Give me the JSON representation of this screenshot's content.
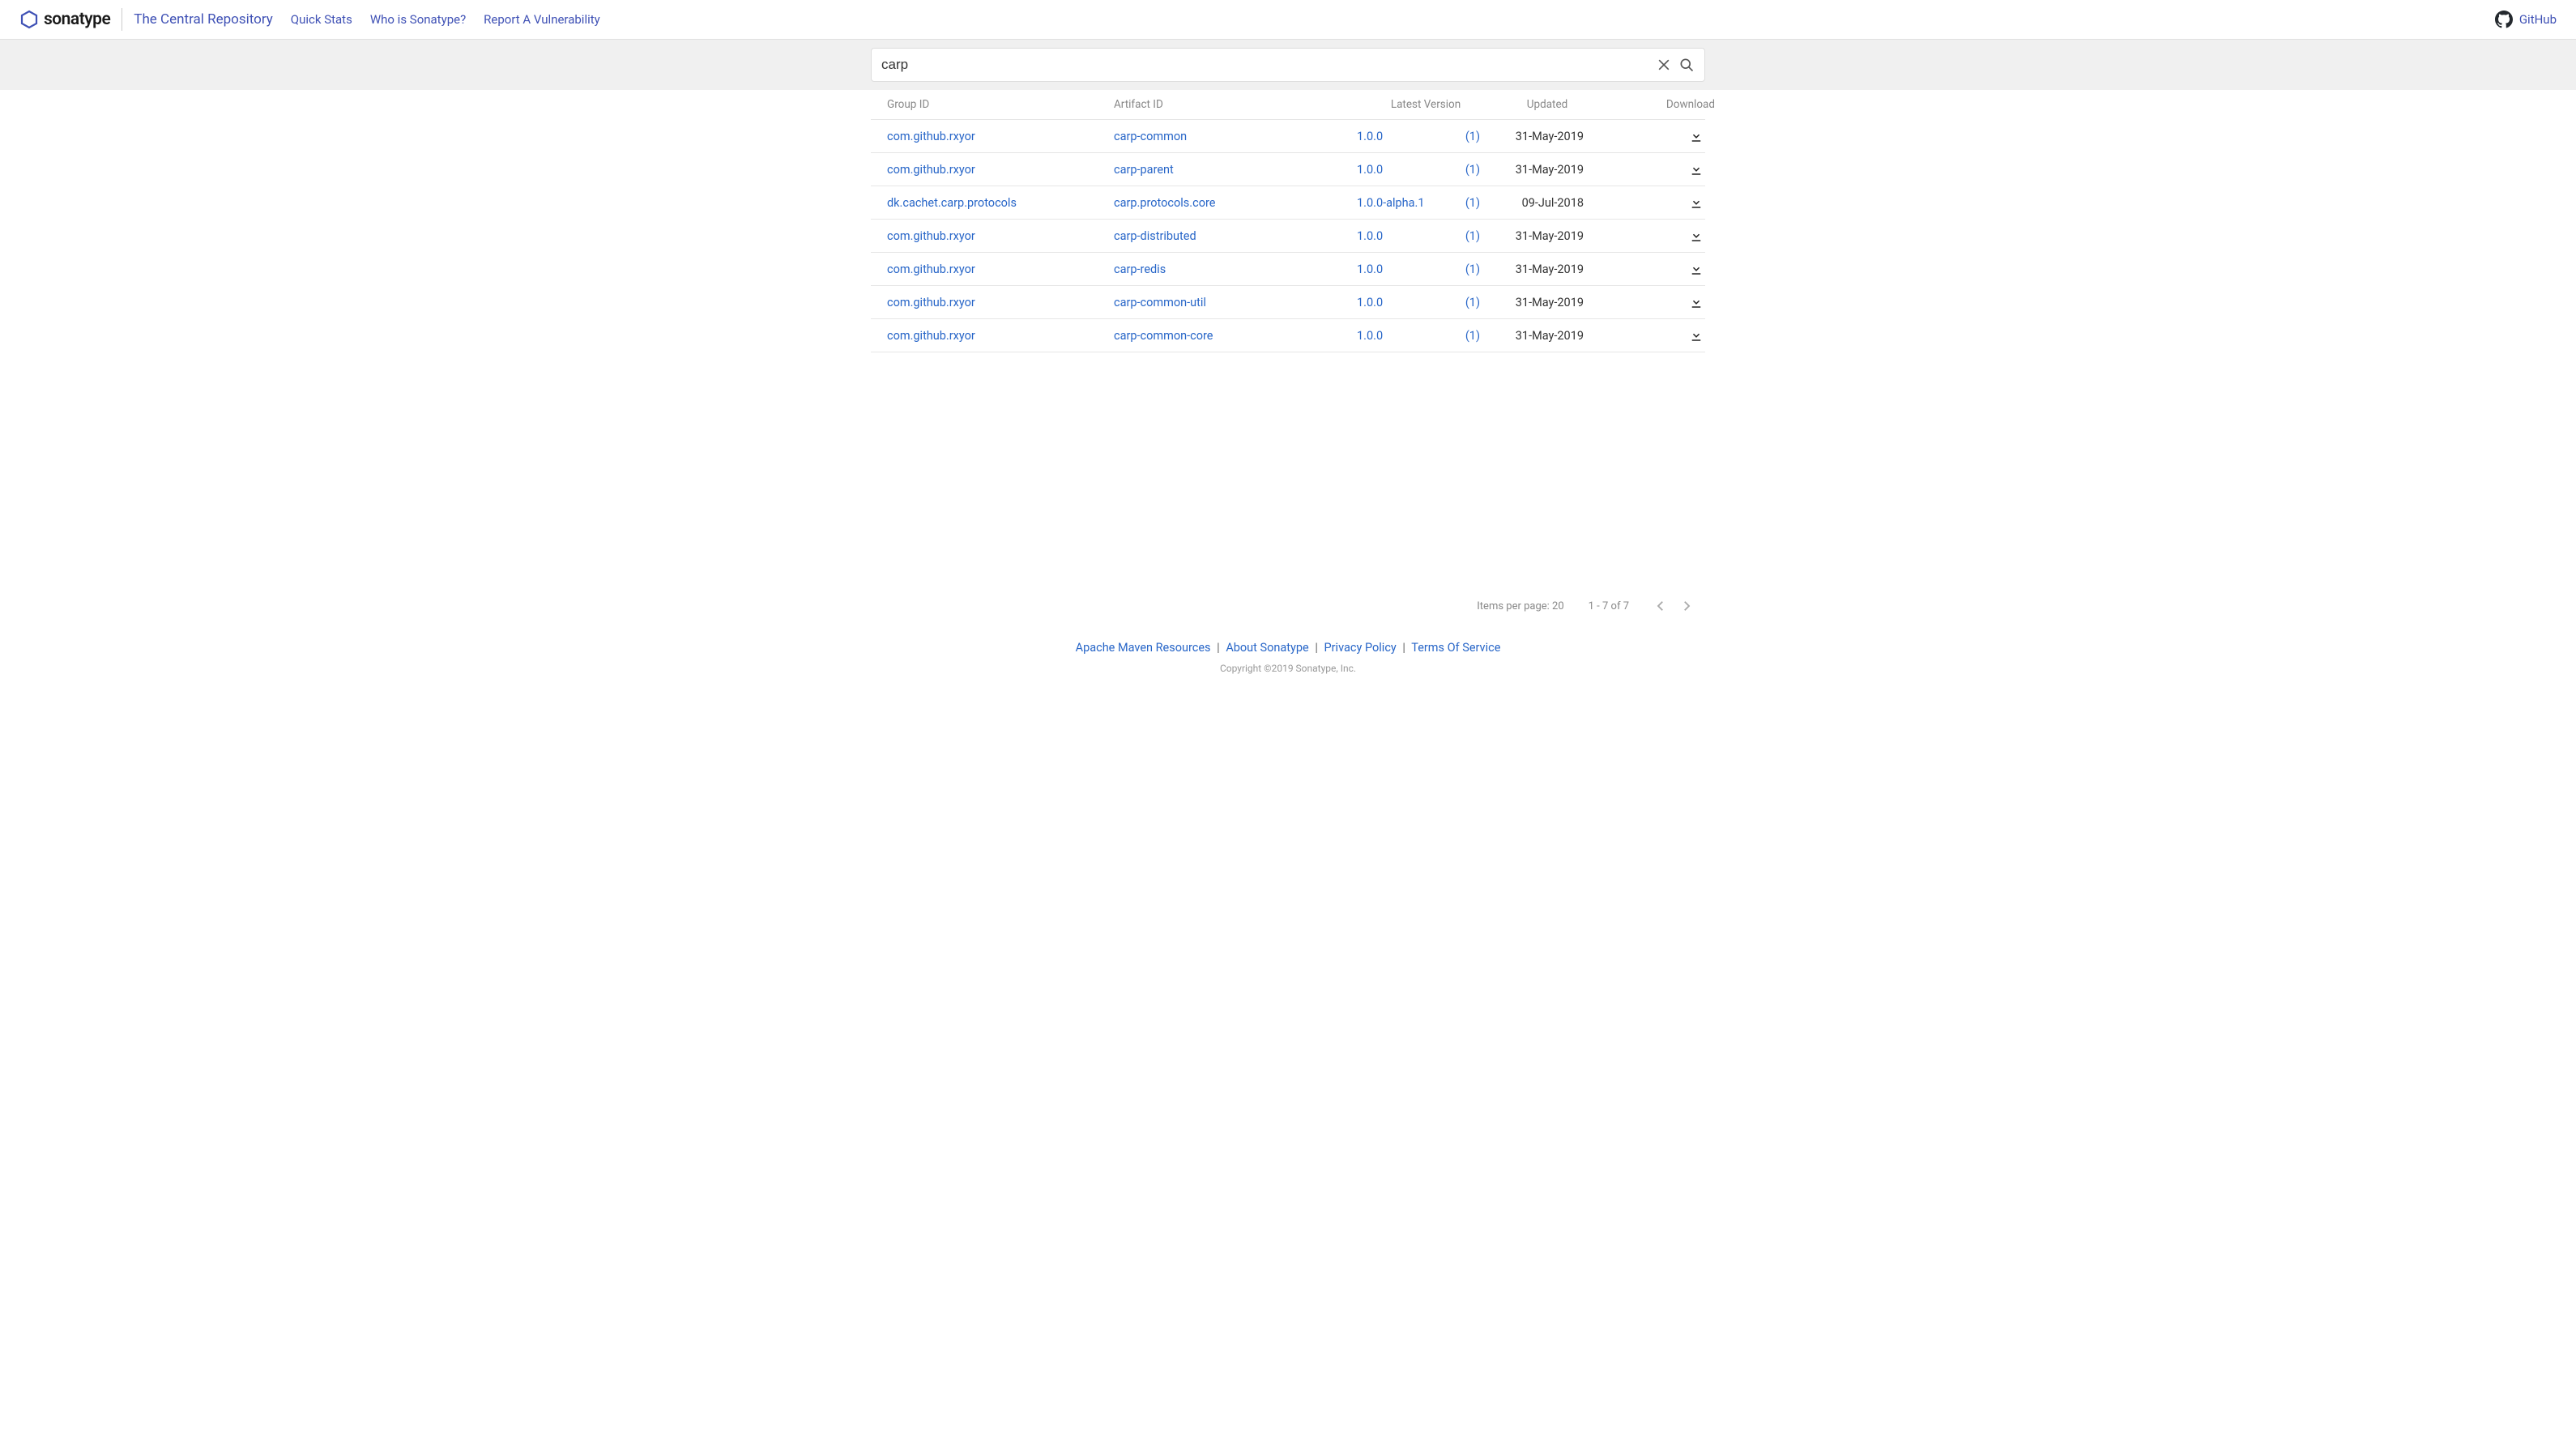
{
  "header": {
    "logo_text": "sonatype",
    "title": "The Central Repository",
    "nav": [
      "Quick Stats",
      "Who is Sonatype?",
      "Report A Vulnerability"
    ],
    "github": "GitHub"
  },
  "search": {
    "value": "carp"
  },
  "table": {
    "headers": {
      "group": "Group ID",
      "artifact": "Artifact ID",
      "version": "Latest Version",
      "updated": "Updated",
      "download": "Download"
    },
    "rows": [
      {
        "group": "com.github.rxyor",
        "artifact": "carp-common",
        "version": "1.0.0",
        "count": "(1)",
        "updated": "31-May-2019"
      },
      {
        "group": "com.github.rxyor",
        "artifact": "carp-parent",
        "version": "1.0.0",
        "count": "(1)",
        "updated": "31-May-2019"
      },
      {
        "group": "dk.cachet.carp.protocols",
        "artifact": "carp.protocols.core",
        "version": "1.0.0-alpha.1",
        "count": "(1)",
        "updated": "09-Jul-2018"
      },
      {
        "group": "com.github.rxyor",
        "artifact": "carp-distributed",
        "version": "1.0.0",
        "count": "(1)",
        "updated": "31-May-2019"
      },
      {
        "group": "com.github.rxyor",
        "artifact": "carp-redis",
        "version": "1.0.0",
        "count": "(1)",
        "updated": "31-May-2019"
      },
      {
        "group": "com.github.rxyor",
        "artifact": "carp-common-util",
        "version": "1.0.0",
        "count": "(1)",
        "updated": "31-May-2019"
      },
      {
        "group": "com.github.rxyor",
        "artifact": "carp-common-core",
        "version": "1.0.0",
        "count": "(1)",
        "updated": "31-May-2019"
      }
    ]
  },
  "pager": {
    "items_per_page": "Items per page: 20",
    "range": "1 - 7 of 7"
  },
  "footer": {
    "links": [
      "Apache Maven Resources",
      "About Sonatype",
      "Privacy Policy",
      "Terms Of Service"
    ],
    "copyright": "Copyright ©2019 Sonatype, Inc."
  }
}
